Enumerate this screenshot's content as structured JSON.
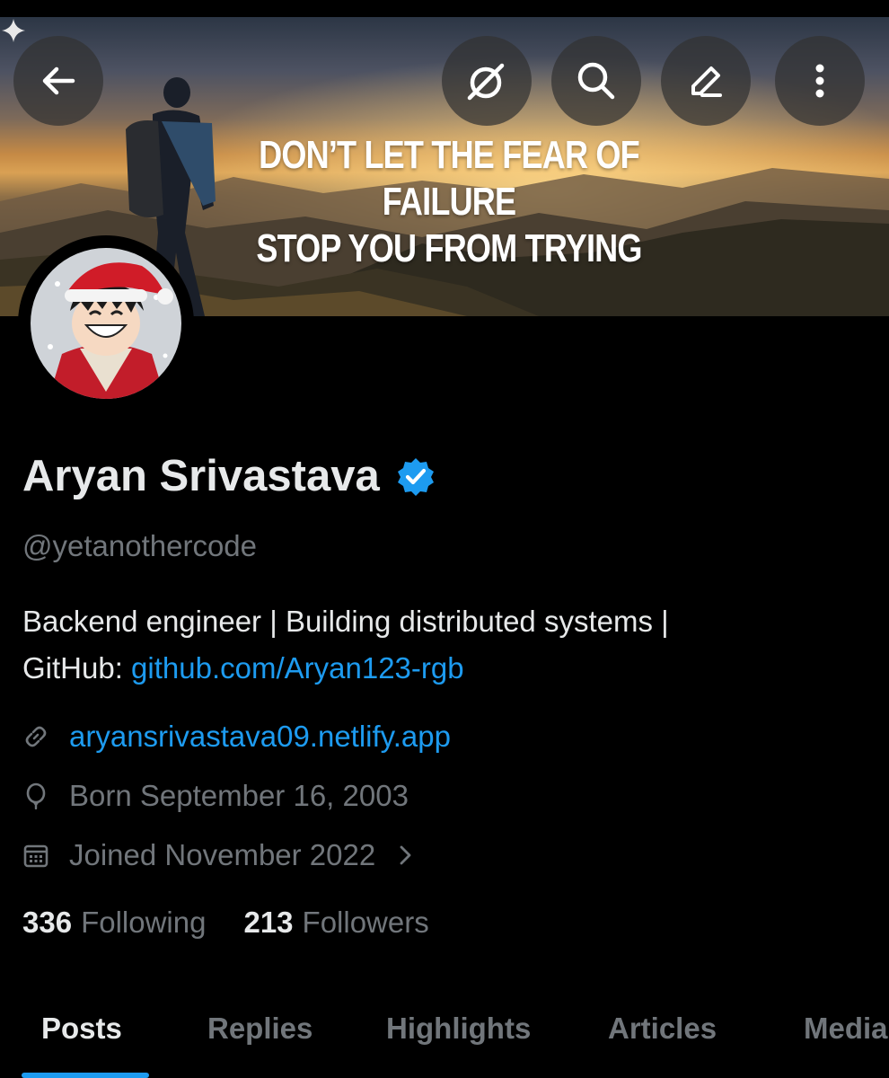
{
  "banner": {
    "quote_line1": "DON’T LET THE FEAR OF FAILURE",
    "quote_line2": "STOP YOU FROM TRYING"
  },
  "toolbar": {
    "icons": [
      "back-arrow-icon",
      "grok-icon",
      "search-icon",
      "edit-icon",
      "more-vertical-icon"
    ]
  },
  "profile": {
    "name": "Aryan Srivastava",
    "verified": true,
    "handle": "@yetanothercode",
    "bio_text": "Backend engineer | Building distributed systems |",
    "bio_prefix": "GitHub: ",
    "bio_link": "github.com/Aryan123-rgb",
    "website": "aryansrivastava09.netlify.app",
    "birthday": "Born September 16, 2003",
    "joined": "Joined November 2022"
  },
  "stats": {
    "following_count": "336",
    "following_label": "Following",
    "followers_count": "213",
    "followers_label": "Followers"
  },
  "tabs": [
    {
      "label": "Posts",
      "active": true
    },
    {
      "label": "Replies",
      "active": false
    },
    {
      "label": "Highlights",
      "active": false
    },
    {
      "label": "Articles",
      "active": false
    },
    {
      "label": "Media",
      "active": false
    }
  ],
  "colors": {
    "accent": "#1d9bf0",
    "text_primary": "#e7e9ea",
    "text_secondary": "#71767b",
    "background": "#000000"
  }
}
